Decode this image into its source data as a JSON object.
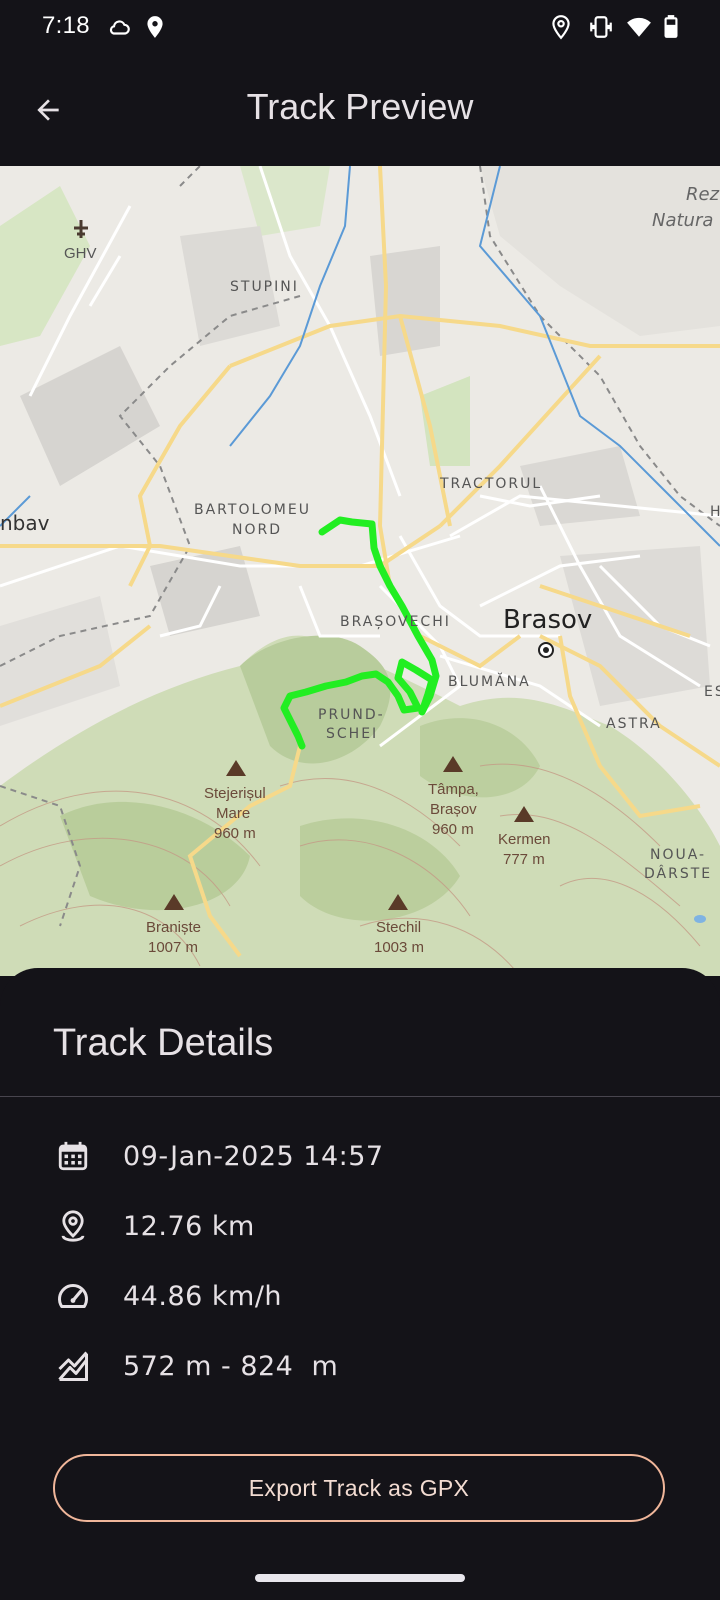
{
  "status_bar": {
    "time": "7:18"
  },
  "header": {
    "title": "Track Preview",
    "back_icon": "arrow-back-icon"
  },
  "map": {
    "area_labels": [
      "STUPINI",
      "BARTOLOMEU",
      "NORD",
      "TRACTORUL",
      "BRAȘOVECHI",
      "BLUMĂNA",
      "PRUND-",
      "SCHEI",
      "ASTRA",
      "NOUA-",
      "DÂRSTE",
      "ES",
      "H"
    ],
    "city": "Brasov",
    "airport": "GHV",
    "left_town": "nbav",
    "reserve": [
      "Rez",
      "Natura"
    ],
    "peaks": [
      {
        "name1": "Stejerișul",
        "name2": "Mare",
        "elev": "960 m"
      },
      {
        "name1": "Tâmpa,",
        "name2": "Brașov",
        "elev": "960 m"
      },
      {
        "name1": "Kermen",
        "name2": "",
        "elev": "777 m"
      },
      {
        "name1": "Braniște",
        "name2": "",
        "elev": "1007 m"
      },
      {
        "name1": "Stechil",
        "name2": "",
        "elev": "1003 m"
      }
    ],
    "track_color": "#22ee22"
  },
  "details": {
    "title": "Track Details",
    "date": "09-Jan-2025 14:57",
    "distance": "12.76 km",
    "speed": "44.86 km/h",
    "elevation": "572 m - 824  m",
    "export_label": "Export Track as GPX"
  },
  "colors": {
    "background": "#141318",
    "accent_outline": "#f0b69a",
    "track": "#22ee22"
  }
}
